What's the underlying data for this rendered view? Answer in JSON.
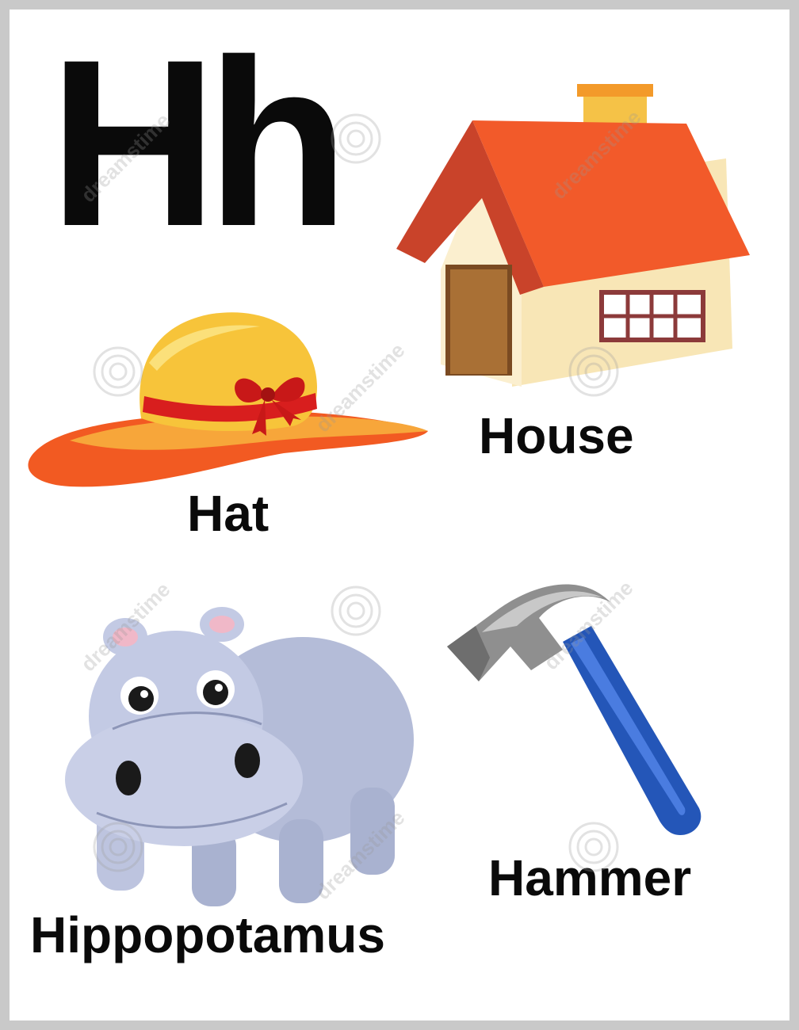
{
  "poster": {
    "letter": "Hh",
    "items": [
      {
        "word": "House",
        "icon": "house-icon"
      },
      {
        "word": "Hat",
        "icon": "hat-icon"
      },
      {
        "word": "Hippopotamus",
        "icon": "hippopotamus-icon"
      },
      {
        "word": "Hammer",
        "icon": "hammer-icon"
      }
    ],
    "watermark": "dreamstime"
  },
  "colors": {
    "letter": "#0a0a0a",
    "roof": "#f0542a",
    "wall": "#f7e8c0",
    "door": "#9c6a33",
    "hat_crown": "#f7c43a",
    "hat_brim": "#f25a22",
    "ribbon": "#d81e1e",
    "hippo": "#b8c0dc",
    "hammer_head": "#9a9a9a",
    "hammer_handle": "#2456b8"
  }
}
